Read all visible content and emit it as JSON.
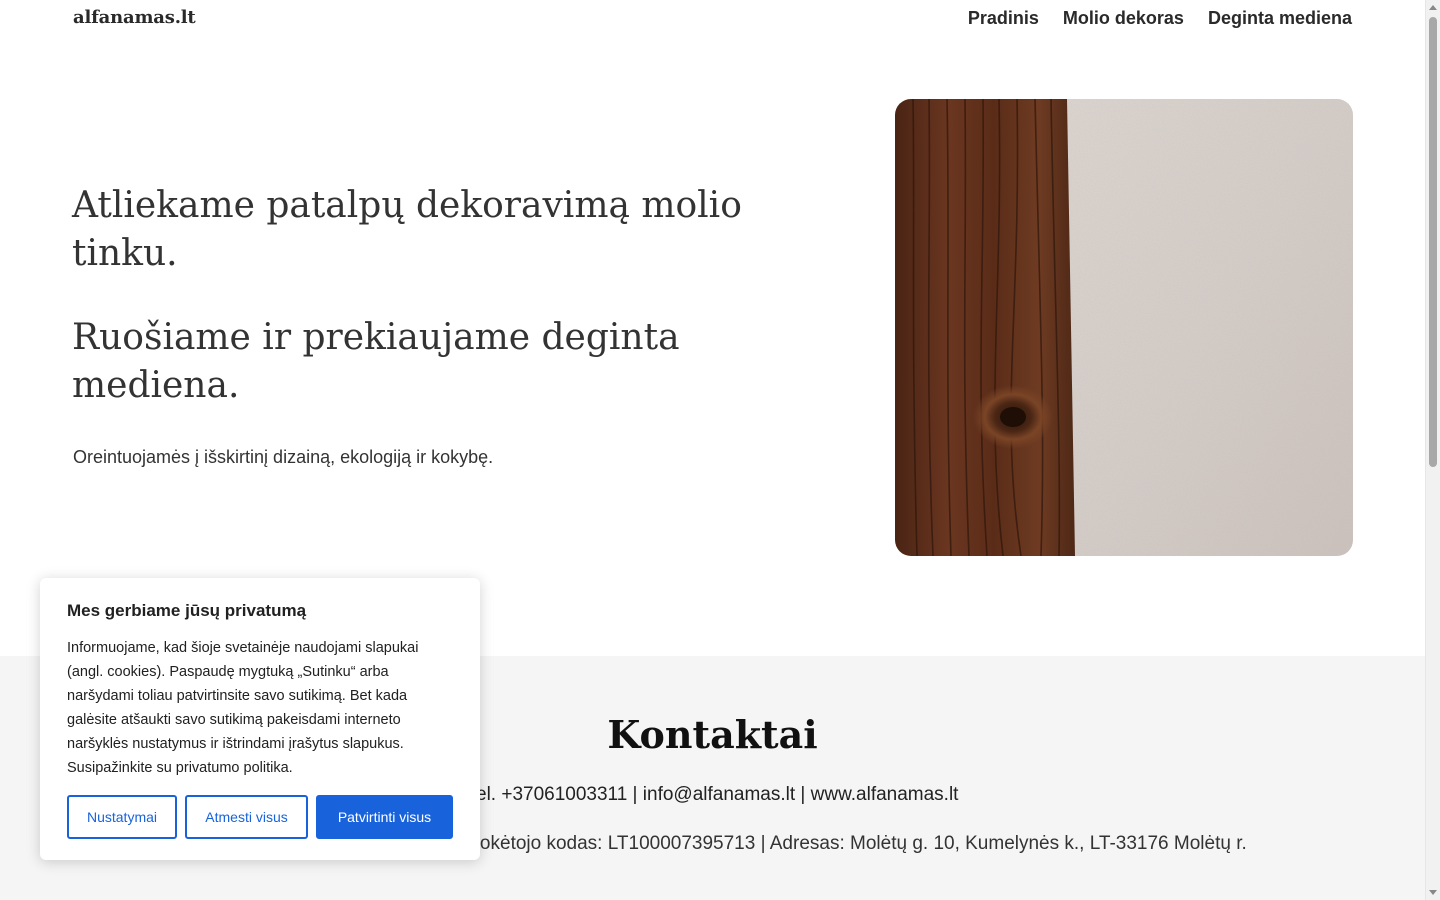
{
  "site": {
    "logo": "alfanamas.lt"
  },
  "nav": {
    "items": [
      "Pradinis",
      "Molio dekoras",
      "Deginta mediena"
    ]
  },
  "hero": {
    "heading1": "Atliekame patalpų dekoravimą molio tinku.",
    "heading2": "Ruošiame ir prekiaujame deginta mediena.",
    "tagline": "Oreintuojamės į išskirtinį dizainą, ekologiją ir kokybę."
  },
  "contacts": {
    "title": "Kontaktai",
    "line1": "Tel. +37061003311 | info@alfanamas.lt | www.alfanamas.lt",
    "line2": "Įmonės kodas: 300083225 | PVM mokėtojo kodas: LT100007395713 | Adresas: Molėtų g. 10, Kumelynės k., LT-33176 Molėtų r."
  },
  "cookie_banner": {
    "title": "Mes gerbiame jūsų privatumą",
    "text": "Informuojame, kad šioje svetainėje naudojami slapukai (angl. cookies). Paspaudę mygtuką „Sutinku“ arba naršydami toliau patvirtinsite savo sutikimą. Bet kada galėsite atšaukti savo sutikimą pakeisdami interneto naršyklės nustatymus ir ištrindami įrašytus slapukus. Susipažinkite su privatumo politika.",
    "buttons": {
      "settings": "Nustatymai",
      "reject": "Atmesti visus",
      "accept": "Patvirtinti visus"
    }
  },
  "colors": {
    "accent": "#1863dc",
    "contacts_bg": "#f5f5f5",
    "wood_dark": "#5a2e1a",
    "plaster": "#d8d0cb"
  }
}
